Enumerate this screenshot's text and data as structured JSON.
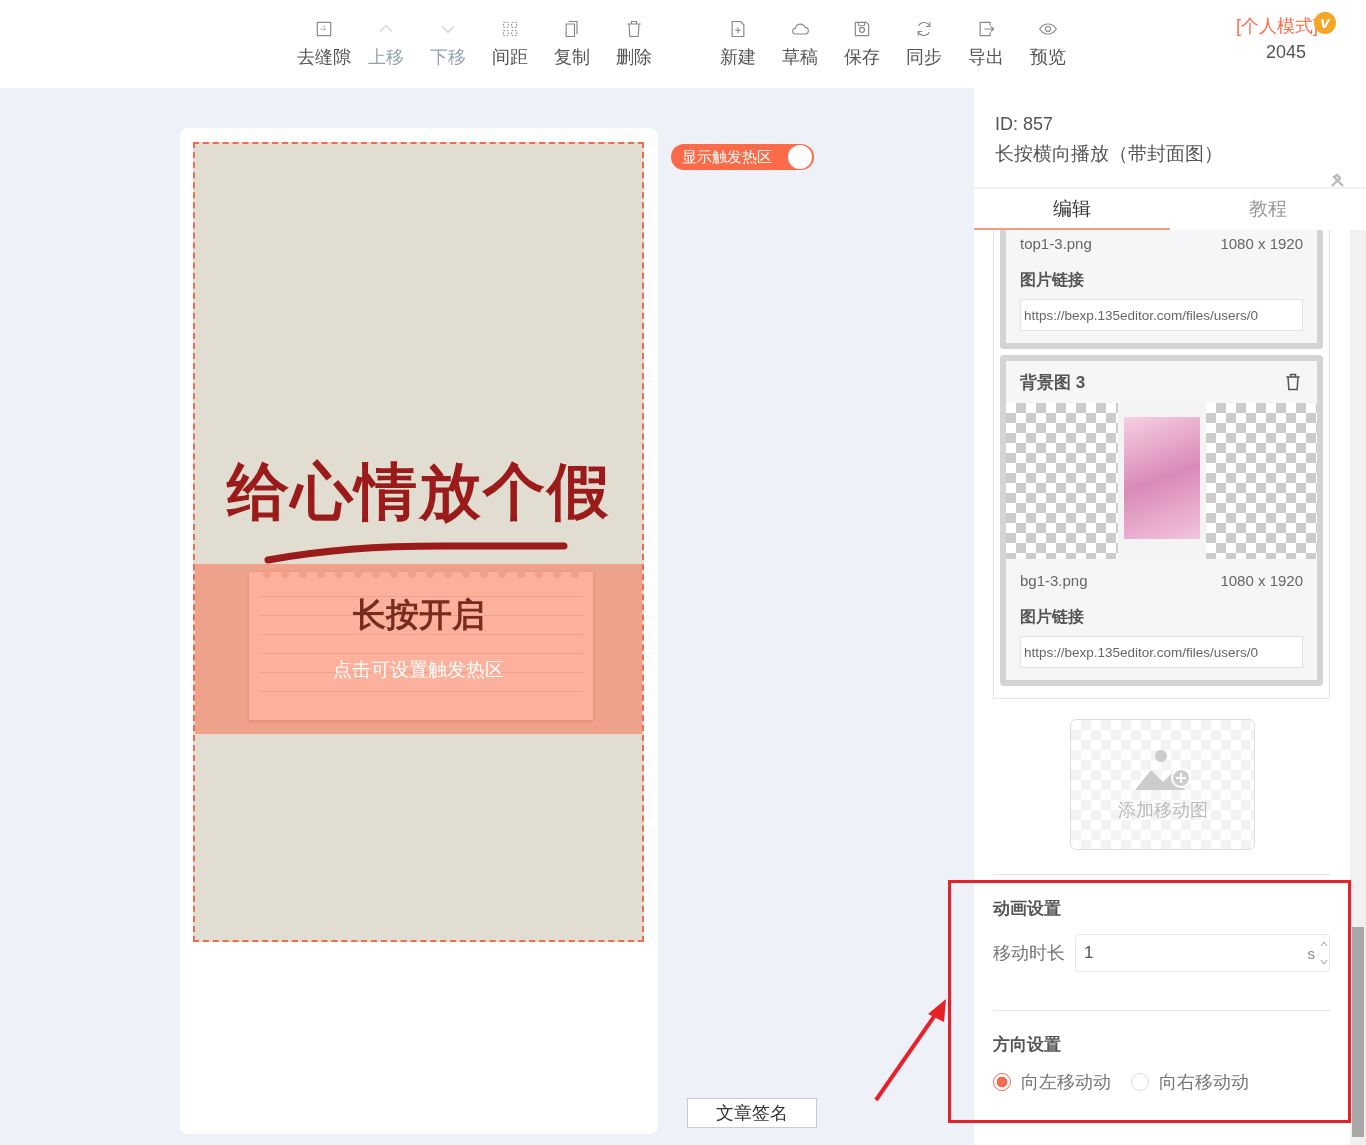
{
  "toolbar": {
    "groups": [
      [
        {
          "label": "去缝隙",
          "disabled": false
        },
        {
          "label": "上移",
          "disabled": true
        },
        {
          "label": "下移",
          "disabled": true
        },
        {
          "label": "间距",
          "disabled": false
        },
        {
          "label": "复制",
          "disabled": false
        },
        {
          "label": "删除",
          "disabled": false
        }
      ],
      [
        {
          "label": "新建",
          "disabled": false
        },
        {
          "label": "草稿",
          "disabled": false
        },
        {
          "label": "保存",
          "disabled": false
        },
        {
          "label": "同步",
          "disabled": false
        },
        {
          "label": "导出",
          "disabled": false
        },
        {
          "label": "预览",
          "disabled": false
        }
      ]
    ]
  },
  "account": {
    "mode": "[个人模式]",
    "badge": "v",
    "count": "2045"
  },
  "canvas": {
    "toggle": {
      "label": "显示触发热区",
      "on": true
    },
    "poster": {
      "headline": "给心情放个假",
      "button_text": "长按开启",
      "hotspot_hint": "点击可设置触发热区"
    },
    "signature_button": "文章签名"
  },
  "panel": {
    "id": "ID: 857",
    "title": "长按横向播放（带封面图）",
    "tabs": [
      {
        "label": "编辑",
        "selected": true
      },
      {
        "label": "教程",
        "selected": false
      }
    ],
    "images": [
      {
        "file": "top1-3.png",
        "size": "1080 x 1920",
        "link_label": "图片链接",
        "link": "https://bexp.135editor.com/files/users/0"
      },
      {
        "title": "背景图 3",
        "file": "bg1-3.png",
        "size": "1080 x 1920",
        "link_label": "图片链接",
        "link": "https://bexp.135editor.com/files/users/0"
      }
    ],
    "add_button": "添加移动图",
    "animation": {
      "heading": "动画设置",
      "duration_label": "移动时长",
      "duration_value": "1",
      "unit": "s"
    },
    "direction": {
      "heading": "方向设置",
      "options": [
        {
          "label": "向左移动动",
          "selected": true
        },
        {
          "label": "向右移动动",
          "selected": false
        }
      ]
    }
  }
}
